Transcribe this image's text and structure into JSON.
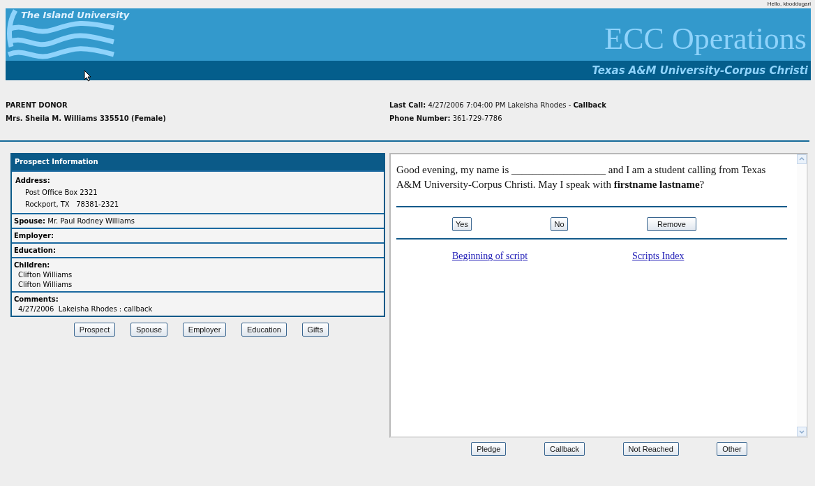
{
  "header": {
    "greeting": "Hello, kboddugari",
    "logo_text": "The Island University",
    "title": "ECC Operations",
    "subtitle": "Texas A&M University-Corpus Christi"
  },
  "donor": {
    "type": "PARENT DONOR",
    "name": "Mrs. Sheila M. Williams 335510 (Female)"
  },
  "call_info": [
    "**Last Call:** 4/27/2006 7:04:00 PM Lakeisha Rhodes - **Callback**",
    "**Phone Number:** 361-729-7786"
  ],
  "prospect": {
    "title": "Prospect Information",
    "sections": [
      {
        "kind": "block",
        "label": "Address:",
        "lines": [
          "Post Office Box 2321",
          "Rockport, TX   78381-2321"
        ]
      },
      {
        "kind": "inline",
        "label": "Spouse:",
        "value": "Mr. Paul Rodney Williams"
      },
      {
        "kind": "inline",
        "label": "Employer:"
      },
      {
        "kind": "inline",
        "label": "Education:"
      },
      {
        "kind": "list",
        "label": "Children:",
        "lines": [
          "Clifton Williams",
          "Clifton Williams"
        ]
      },
      {
        "kind": "list",
        "label": "Comments:",
        "lines": [
          "4/27/2006  Lakeisha Rhodes : callback"
        ]
      }
    ]
  },
  "prospect_buttons": [
    "Prospect",
    "Spouse",
    "Employer",
    "Education",
    "Gifts"
  ],
  "script": {
    "text": "Good evening, my name is __________________ and I am a student calling from Texas A&M University-Corpus Christi. May I speak with **firstname lastname**?",
    "answer_buttons": [
      "Yes",
      "No",
      "Remove"
    ],
    "links": [
      "Beginning of script",
      "Scripts Index"
    ]
  },
  "outcome_buttons": [
    "Pledge",
    "Callback",
    "Not Reached",
    "Other"
  ]
}
